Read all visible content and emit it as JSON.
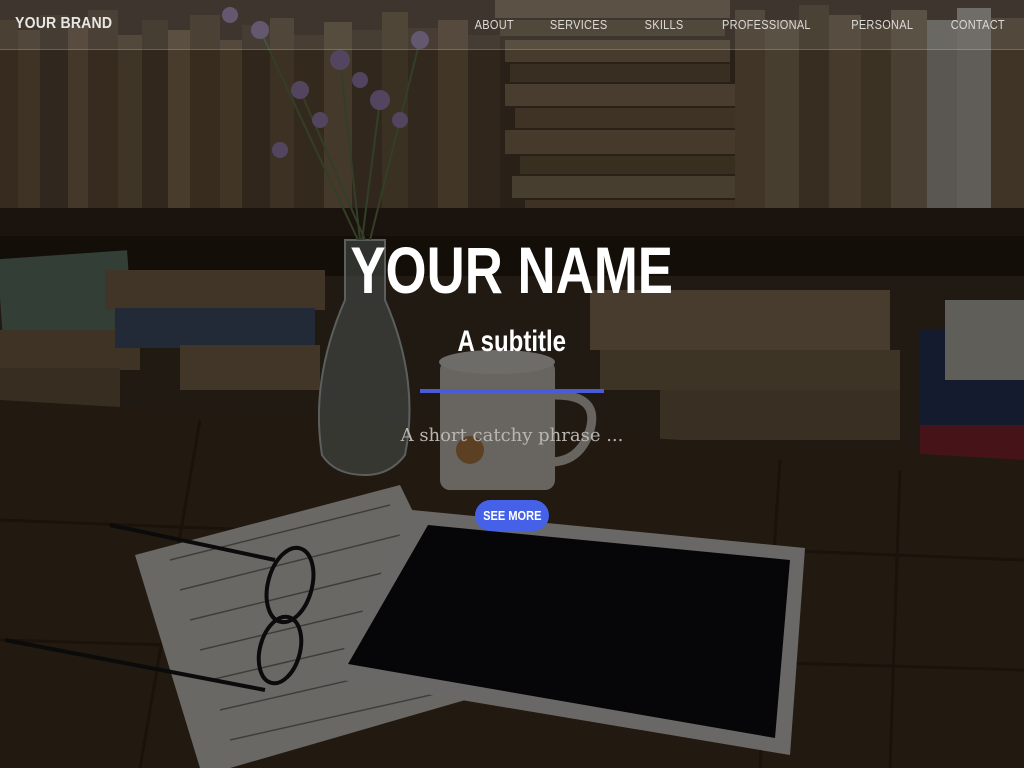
{
  "navbar": {
    "brand": "YOUR BRAND",
    "links": [
      "ABOUT",
      "SERVICES",
      "SKILLS",
      "PROFESSIONAL",
      "PERSONAL",
      "CONTACT"
    ]
  },
  "hero": {
    "title": "YOUR NAME",
    "subtitle": "A subtitle",
    "tagline": "A short catchy phrase ...",
    "cta_label": "SEE MORE"
  },
  "colors": {
    "accent": "#4561e8",
    "divider": "#4a5bd6",
    "overlay": "rgba(0,0,0,0.55)"
  },
  "icons": {
    "background": "desk-photo-books-tablet-notebook"
  }
}
